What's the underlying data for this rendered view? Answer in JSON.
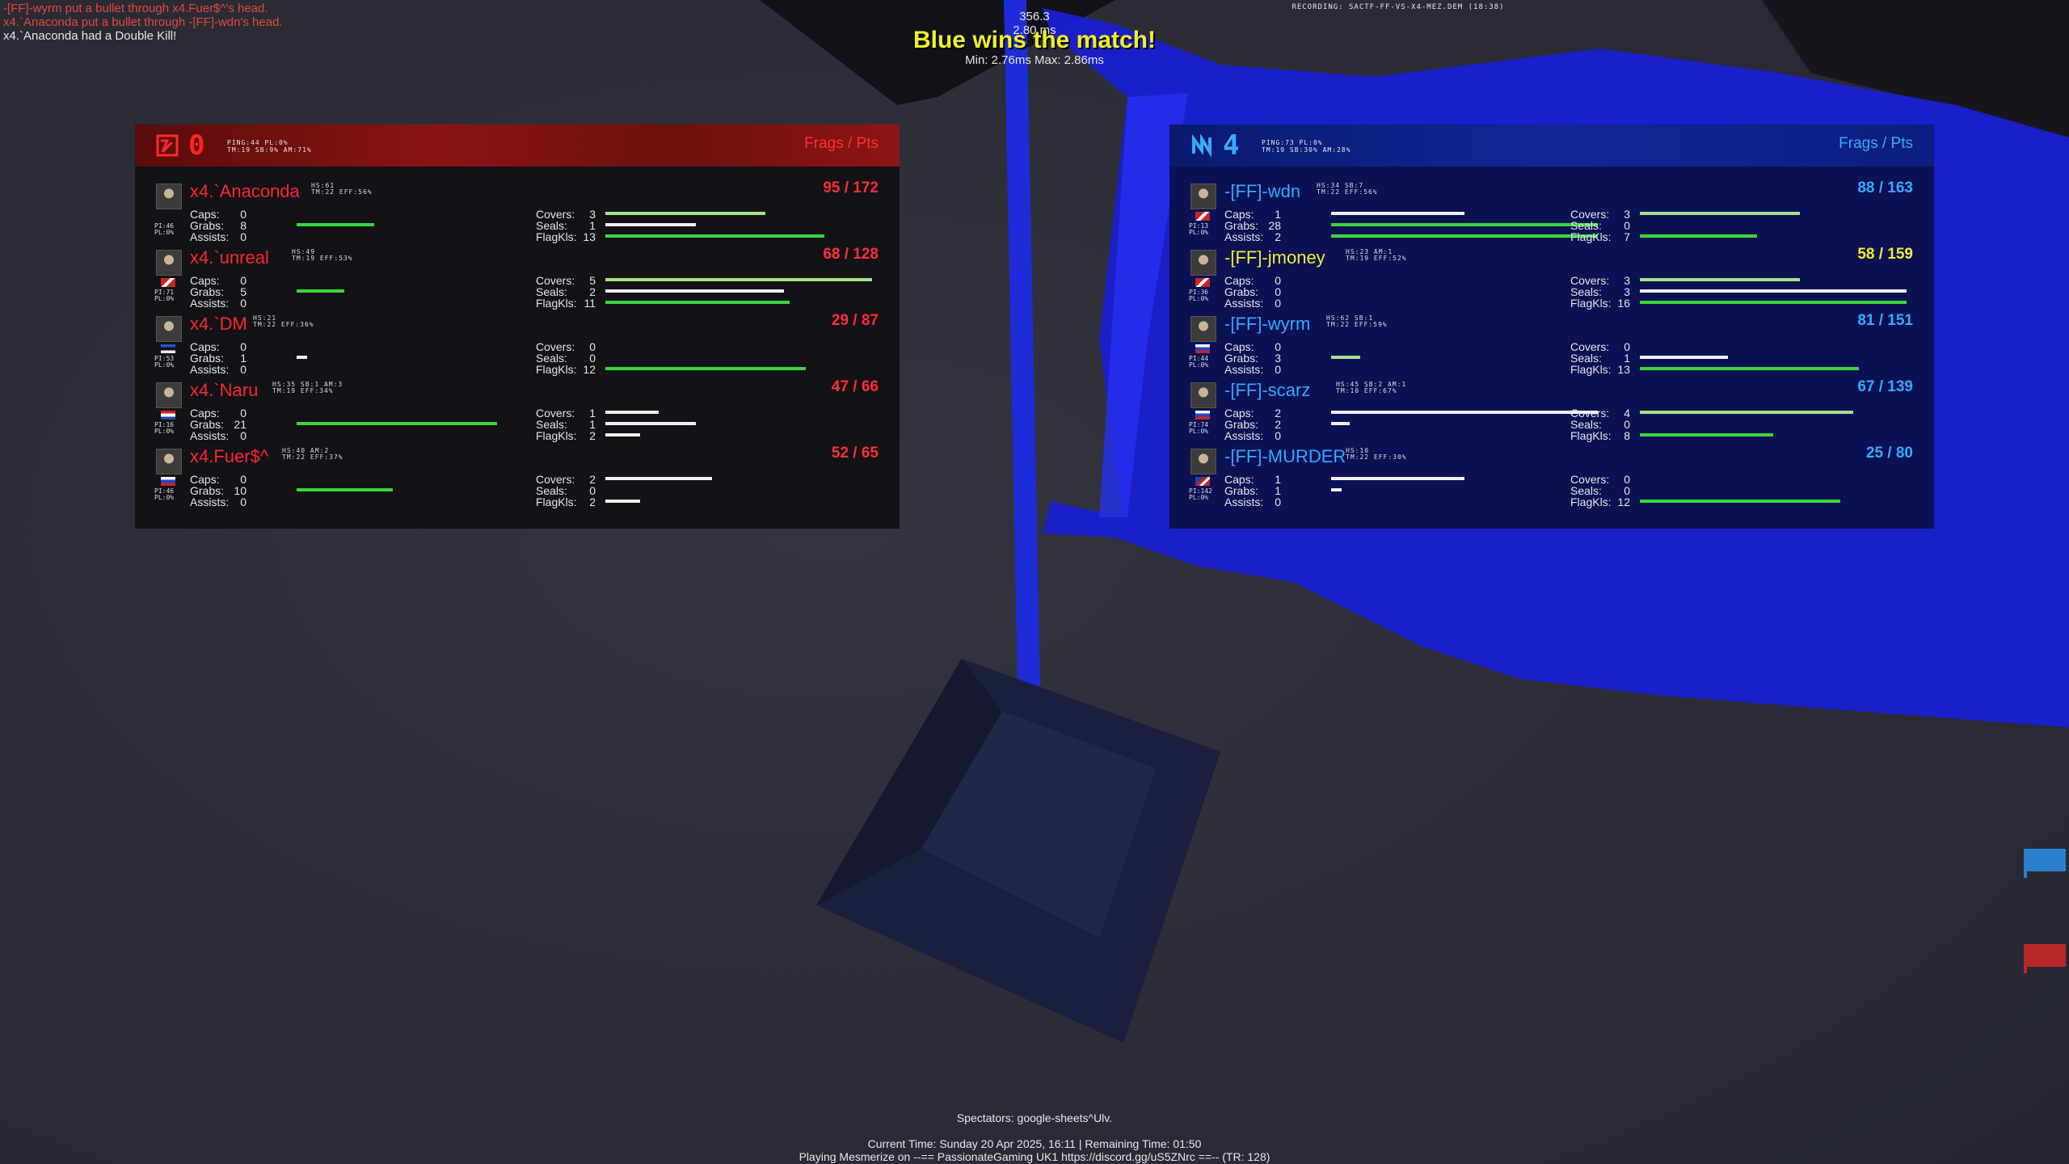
{
  "killfeed": [
    {
      "text": "-[FF]-wyrm put a bullet through x4.Fuer$^'s head.",
      "color": "red"
    },
    {
      "text": "x4.`Anaconda put a bullet through -[FF]-wdn's head.",
      "color": "red"
    },
    {
      "text": "x4.`Anaconda had a Double Kill!",
      "color": "white"
    }
  ],
  "net": {
    "fps": "356.3",
    "ping": "2.80 ms",
    "minmax": "Min: 2.76ms Max: 2.86ms"
  },
  "banner": "Blue wins the match!",
  "recording": "RECORDING: SACTF-FF-VS-X4-MEZ.DEM (18:38)",
  "colors": {
    "red_team": "#ff2828",
    "blue_team": "#38a8ff",
    "highlight": "#f2ee2a",
    "bar_green": "#38d838"
  },
  "teams": {
    "red": {
      "score": "0",
      "info_line1": "PING:44 PL:0%",
      "info_line2": "TM:19 SB:9% AM:71%",
      "header_label": "Frags / Pts",
      "logo_icon": "red-team-emblem-icon",
      "players": [
        {
          "name": "x4.`Anaconda",
          "sub1": "HS:61",
          "sub2": "TM:22 EFF:56%",
          "score": "95 / 172",
          "info1": "PI:46",
          "info2": "PL:0%",
          "flag": "none",
          "caps": "0",
          "grabs": "8",
          "assists": "0",
          "covers": "3",
          "seals": "1",
          "flagkls": "13",
          "bars": {
            "caps": 0,
            "grabs": 0.29,
            "assists": 0,
            "covers": 0.6,
            "seals": 0.34,
            "flagkls": 0.82
          }
        },
        {
          "name": "x4.`unreal",
          "sub1": "HS:49",
          "sub2": "TM:19 EFF:53%",
          "score": "68 / 128",
          "info1": "PI:71",
          "info2": "PL:0%",
          "flag": "uk",
          "caps": "0",
          "grabs": "5",
          "assists": "0",
          "covers": "5",
          "seals": "2",
          "flagkls": "11",
          "bars": {
            "caps": 0,
            "grabs": 0.18,
            "assists": 0,
            "covers": 1.0,
            "seals": 0.67,
            "flagkls": 0.69
          }
        },
        {
          "name": "x4.`DM",
          "sub1": "HS:21",
          "sub2": "TM:22 EFF:36%",
          "score": "29 / 87",
          "info1": "PI:53",
          "info2": "PL:0%",
          "flag": "ee",
          "caps": "0",
          "grabs": "1",
          "assists": "0",
          "covers": "0",
          "seals": "0",
          "flagkls": "12",
          "bars": {
            "caps": 0,
            "grabs": 0.04,
            "assists": 0,
            "covers": 0,
            "seals": 0,
            "flagkls": 0.75
          }
        },
        {
          "name": "x4.`Naru",
          "sub1": "HS:35 SB:1 AM:3",
          "sub2": "TM:19 EFF:34%",
          "score": "47 / 66",
          "info1": "PI:16",
          "info2": "PL:0%",
          "flag": "nl",
          "caps": "0",
          "grabs": "21",
          "assists": "0",
          "covers": "1",
          "seals": "1",
          "flagkls": "2",
          "bars": {
            "caps": 0,
            "grabs": 0.75,
            "assists": 0,
            "covers": 0.2,
            "seals": 0.34,
            "flagkls": 0.13
          }
        },
        {
          "name": "x4.Fuer$^",
          "sub1": "HS:40 AM:2",
          "sub2": "TM:22 EFF:37%",
          "score": "52 / 65",
          "info1": "PI:46",
          "info2": "PL:0%",
          "flag": "ru",
          "caps": "0",
          "grabs": "10",
          "assists": "0",
          "covers": "2",
          "seals": "0",
          "flagkls": "2",
          "bars": {
            "caps": 0,
            "grabs": 0.36,
            "assists": 0,
            "covers": 0.4,
            "seals": 0,
            "flagkls": 0.13
          }
        }
      ]
    },
    "blue": {
      "score": "4",
      "info_line1": "PING:73 PL:0%",
      "info_line2": "TM:19 SB:30% AM:28%",
      "header_label": "Frags / Pts",
      "logo_icon": "blue-team-emblem-icon",
      "players": [
        {
          "name": "-[FF]-wdn",
          "sub1": "HS:34 SB:7",
          "sub2": "TM:22 EFF:56%",
          "score": "88 / 163",
          "info1": "PI:13",
          "info2": "PL:0%",
          "flag": "uk",
          "hl": false,
          "caps": "1",
          "grabs": "28",
          "assists": "2",
          "covers": "3",
          "seals": "0",
          "flagkls": "7",
          "bars": {
            "caps": 0.5,
            "grabs": 1.0,
            "assists": 1.0,
            "covers": 0.6,
            "seals": 0,
            "flagkls": 0.44
          }
        },
        {
          "name": "-[FF]-jmoney",
          "sub1": "HS:23 AM:1",
          "sub2": "TM:19 EFF:52%",
          "score": "58 / 159",
          "info1": "PI:36",
          "info2": "PL:0%",
          "flag": "uk",
          "hl": true,
          "caps": "0",
          "grabs": "0",
          "assists": "0",
          "covers": "3",
          "seals": "3",
          "flagkls": "16",
          "bars": {
            "caps": 0,
            "grabs": 0,
            "assists": 0,
            "covers": 0.6,
            "seals": 1.0,
            "flagkls": 1.0
          }
        },
        {
          "name": "-[FF]-wyrm",
          "sub1": "HS:62 SB:1",
          "sub2": "TM:22 EFF:59%",
          "score": "81 / 151",
          "info1": "PI:44",
          "info2": "PL:0%",
          "flag": "ru",
          "hl": false,
          "caps": "0",
          "grabs": "3",
          "assists": "0",
          "covers": "0",
          "seals": "1",
          "flagkls": "13",
          "bars": {
            "caps": 0,
            "grabs": 0.11,
            "assists": 0,
            "covers": 0,
            "seals": 0.33,
            "flagkls": 0.82
          }
        },
        {
          "name": "-[FF]-scarz",
          "sub1": "HS:45 SB:2 AM:1",
          "sub2": "TM:10 EFF:67%",
          "score": "67 / 139",
          "info1": "PI:74",
          "info2": "PL:0%",
          "flag": "ru",
          "hl": false,
          "caps": "2",
          "grabs": "2",
          "assists": "0",
          "covers": "4",
          "seals": "0",
          "flagkls": "8",
          "bars": {
            "caps": 1.0,
            "grabs": 0.07,
            "assists": 0,
            "covers": 0.8,
            "seals": 0,
            "flagkls": 0.5
          }
        },
        {
          "name": "-[FF]-MURDER",
          "sub1": "HS:10",
          "sub2": "TM:22 EFF:30%",
          "score": "25 / 80",
          "info1": "PI:142",
          "info2": "PL:0%",
          "flag": "us",
          "hl": false,
          "caps": "1",
          "grabs": "1",
          "assists": "0",
          "covers": "0",
          "seals": "0",
          "flagkls": "12",
          "bars": {
            "caps": 0.5,
            "grabs": 0.04,
            "assists": 0,
            "covers": 0,
            "seals": 0,
            "flagkls": 0.75
          }
        }
      ]
    }
  },
  "stat_labels": {
    "caps": "Caps:",
    "grabs": "Grabs:",
    "assists": "Assists:",
    "covers": "Covers:",
    "seals": "Seals:",
    "flagkls": "FlagKls:"
  },
  "spectators": "Spectators: google-sheets^Ulv.",
  "bottom": {
    "line1": "Current Time: Sunday 20 Apr 2025, 16:11 | Remaining Time: 01:50",
    "line2": "Playing Mesmerize on --== PassionateGaming UK1 https://discord.gg/uS5ZNrc ==-- (TR: 128)"
  }
}
